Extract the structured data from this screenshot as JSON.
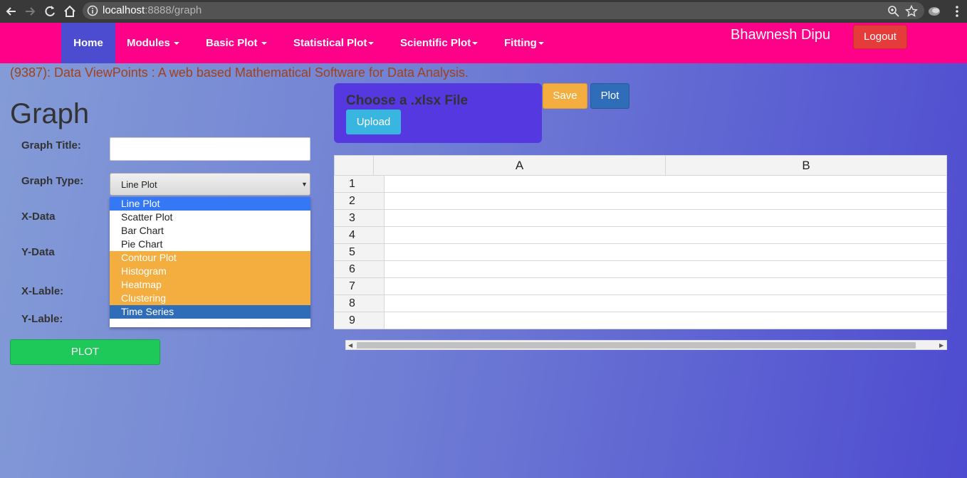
{
  "browser": {
    "url_host": "localhost",
    "url_rest": ":8888/graph"
  },
  "navbar": {
    "items": [
      {
        "label": "Home"
      },
      {
        "label": "Modules"
      },
      {
        "label": "Basic Plot"
      },
      {
        "label": "Statistical Plot"
      },
      {
        "label": "Scientific Plot"
      },
      {
        "label": "Fitting"
      }
    ],
    "user": "Bhawnesh Dipu",
    "logout_label": "Logout"
  },
  "subtitle": "(9387): Data ViewPoints : A web based Mathematical Software for Data Analysis.",
  "form": {
    "heading": "Graph",
    "title_label": "Graph Title:",
    "title_value": "",
    "type_label": "Graph Type:",
    "type_value": "Line Plot",
    "xdata_label": "X-Data",
    "ydata_label": "Y-Data",
    "xlabel_label": "X-Lable:",
    "ylabel_label": "Y-Lable:",
    "plot_label": "PLOT",
    "options": [
      {
        "label": "Line Plot"
      },
      {
        "label": "Scatter Plot"
      },
      {
        "label": "Bar Chart"
      },
      {
        "label": "Pie Chart"
      },
      {
        "label": "Contour Plot"
      },
      {
        "label": "Histogram"
      },
      {
        "label": "Heatmap"
      },
      {
        "label": "Clustering"
      },
      {
        "label": "Time Series"
      }
    ]
  },
  "upload": {
    "title": "Choose a .xlsx File",
    "upload_label": "Upload",
    "save_label": "Save",
    "plot_label": "Plot"
  },
  "sheet": {
    "columns": [
      "A",
      "B"
    ],
    "rows": [
      "1",
      "2",
      "3",
      "4",
      "5",
      "6",
      "7",
      "8",
      "9"
    ]
  },
  "colors": {
    "navbar": "#ff0088",
    "active_nav": "#4b4cd0",
    "selected_option": "#3478f6",
    "highlight_options": "#f4ae3f",
    "time_series_option": "#2f6db9",
    "plot_button": "#1ec95a",
    "upload_panel": "#5538e0"
  }
}
